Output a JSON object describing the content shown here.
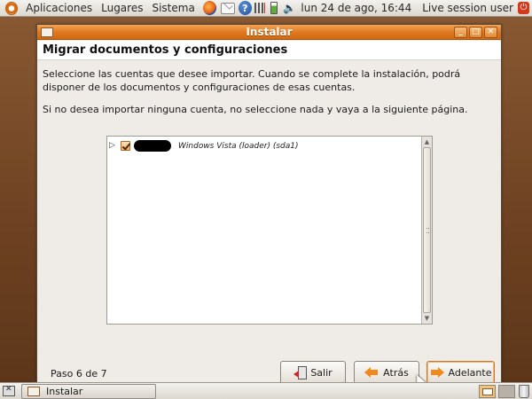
{
  "top_panel": {
    "menus": [
      "Aplicaciones",
      "Lugares",
      "Sistema"
    ],
    "clock": "lun 24 de ago, 16:44",
    "session": "Live session user",
    "icons": [
      "ubuntu-logo",
      "firefox-icon",
      "mail-icon",
      "help-icon",
      "network-icon",
      "battery-icon",
      "volume-icon",
      "power-icon"
    ]
  },
  "window": {
    "title": "Instalar",
    "page_title": "Migrar documentos y configuraciones",
    "para1": "Seleccione las cuentas que desee importar. Cuando se complete la instalación, podrá disponer de los documentos y configuraciones de esas cuentas.",
    "para2": "Si no desea importar ninguna cuenta, no seleccione nada y vaya a la siguiente página.",
    "accounts": [
      {
        "label": "Windows Vista (loader) (sda1)",
        "checked": true,
        "expanded": false
      }
    ],
    "step": "Paso 6 de 7",
    "buttons": {
      "quit": "Salir",
      "back": "Atrás",
      "forward": "Adelante"
    }
  },
  "bottom_panel": {
    "task": "Instalar"
  },
  "colors": {
    "titlebar": "#df7a22",
    "accent": "#f08a1c",
    "desktop": "#6e4222",
    "dialog_bg": "#efebe7"
  }
}
